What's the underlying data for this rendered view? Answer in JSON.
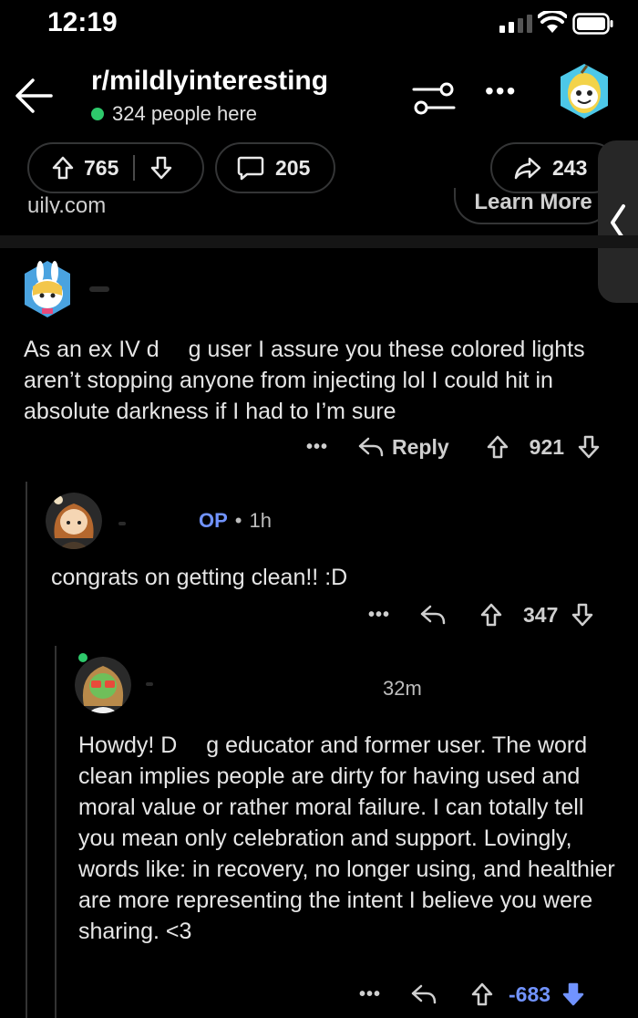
{
  "status": {
    "time": "12:19"
  },
  "header": {
    "subreddit": "r/mildlyinteresting",
    "presence": "324 people here"
  },
  "post_actions": {
    "upvotes": "765",
    "comments": "205",
    "shares": "243"
  },
  "behind_text": {
    "left": "uily.com",
    "right": "Learn More"
  },
  "comments": [
    {
      "body": "As an ex IV d  g user I assure you these colored lights aren’t stopping anyone from injecting lol I could hit in absolute darkness if I had to I’m sure",
      "more": "•••",
      "reply_label": "Reply",
      "score": "921"
    },
    {
      "author_tag": "OP",
      "age": "1h",
      "body": "congrats on getting clean!! :D",
      "more": "•••",
      "score": "347"
    },
    {
      "age": "32m",
      "body": "Howdy! D  g educator and former user. The word clean implies people are dirty for having used and moral value or rather moral failure. I can totally tell you mean only celebration and support. Lovingly, words like: in recovery, no longer using, and healthier are more representing the intent I believe you were sharing. <3",
      "more": "•••",
      "score": "-683"
    }
  ],
  "colors": {
    "background": "#000000",
    "online": "#2ec96b",
    "downvote": "#7193ff",
    "border": "#343536"
  }
}
